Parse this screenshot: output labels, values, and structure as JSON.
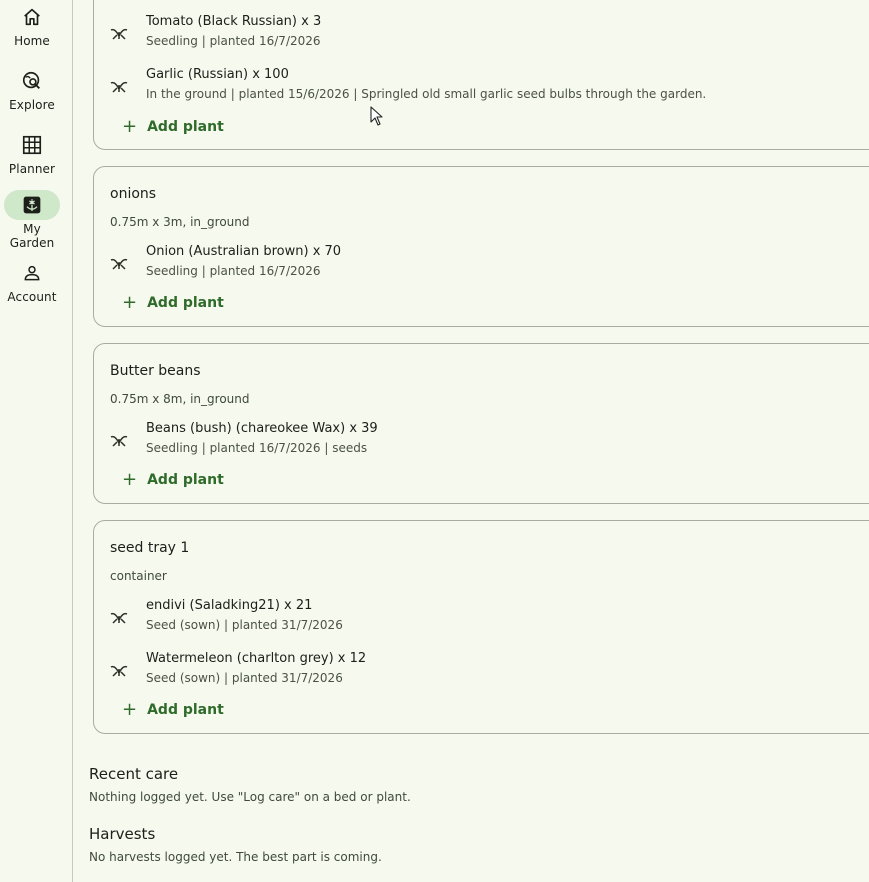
{
  "nav": {
    "items": [
      {
        "label": "Home",
        "icon": "home-icon"
      },
      {
        "label": "Explore",
        "icon": "explore-search-icon"
      },
      {
        "label": "Planner",
        "icon": "grid-icon"
      },
      {
        "label": "My Garden",
        "icon": "flower-icon",
        "active": true
      },
      {
        "label": "Account",
        "icon": "person-icon"
      }
    ]
  },
  "beds": [
    {
      "plants": [
        {
          "title": "Tomato (Black Russian) x 3",
          "sub": "Seedling | planted 16/7/2026"
        },
        {
          "title": "Garlic (Russian) x 100",
          "sub": "In the ground | planted 15/6/2026 | Springled old small garlic seed bulbs through the garden."
        }
      ],
      "add_label": "Add plant"
    },
    {
      "name": "onions",
      "meta": "0.75m x 3m, in_ground",
      "plants": [
        {
          "title": "Onion (Australian brown) x 70",
          "sub": "Seedling | planted 16/7/2026"
        }
      ],
      "add_label": "Add plant"
    },
    {
      "name": "Butter beans",
      "meta": "0.75m x 8m, in_ground",
      "plants": [
        {
          "title": "Beans (bush) (chareokee Wax) x 39",
          "sub": "Seedling | planted 16/7/2026 | seeds"
        }
      ],
      "add_label": "Add plant"
    },
    {
      "name": "seed tray 1",
      "meta": "container",
      "plants": [
        {
          "title": "endivi (Saladking21) x 21",
          "sub": "Seed (sown) | planted 31/7/2026"
        },
        {
          "title": "Watermeleon (charlton grey) x 12",
          "sub": "Seed (sown) | planted 31/7/2026"
        }
      ],
      "add_label": "Add plant"
    }
  ],
  "recent_care": {
    "title": "Recent care",
    "text": "Nothing logged yet. Use \"Log care\" on a bed or plant."
  },
  "harvests": {
    "title": "Harvests",
    "text": "No harvests logged yet. The best part is coming."
  },
  "colors": {
    "accent": "#2f6b2a",
    "active_nav_bg": "#cfe8c9",
    "background": "#f6f9ee"
  }
}
